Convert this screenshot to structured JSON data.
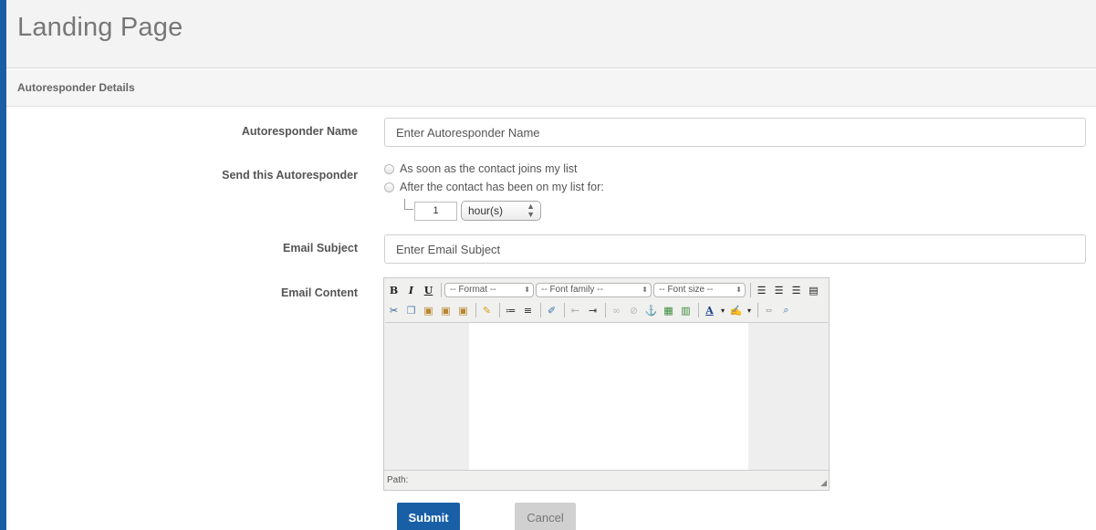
{
  "page": {
    "title": "Landing Page"
  },
  "section": {
    "title": "Autoresponder Details"
  },
  "form": {
    "name": {
      "label": "Autoresponder Name",
      "placeholder": "Enter Autoresponder Name"
    },
    "send": {
      "label": "Send this Autoresponder",
      "options": [
        "As soon as the contact joins my list",
        "After the contact has been on my list for:"
      ],
      "delay_value": "1",
      "delay_unit": "hour(s)"
    },
    "subject": {
      "label": "Email Subject",
      "placeholder": "Enter Email Subject"
    },
    "content": {
      "label": "Email Content",
      "editor": {
        "format_select": "-- Format --",
        "font_family_select": "-- Font family --",
        "font_size_select": "-- Font size --",
        "path_label": "Path:"
      }
    }
  },
  "actions": {
    "submit": "Submit",
    "cancel": "Cancel"
  },
  "colors": {
    "accent": "#185fa6",
    "left_edge": "#1a5da4"
  }
}
